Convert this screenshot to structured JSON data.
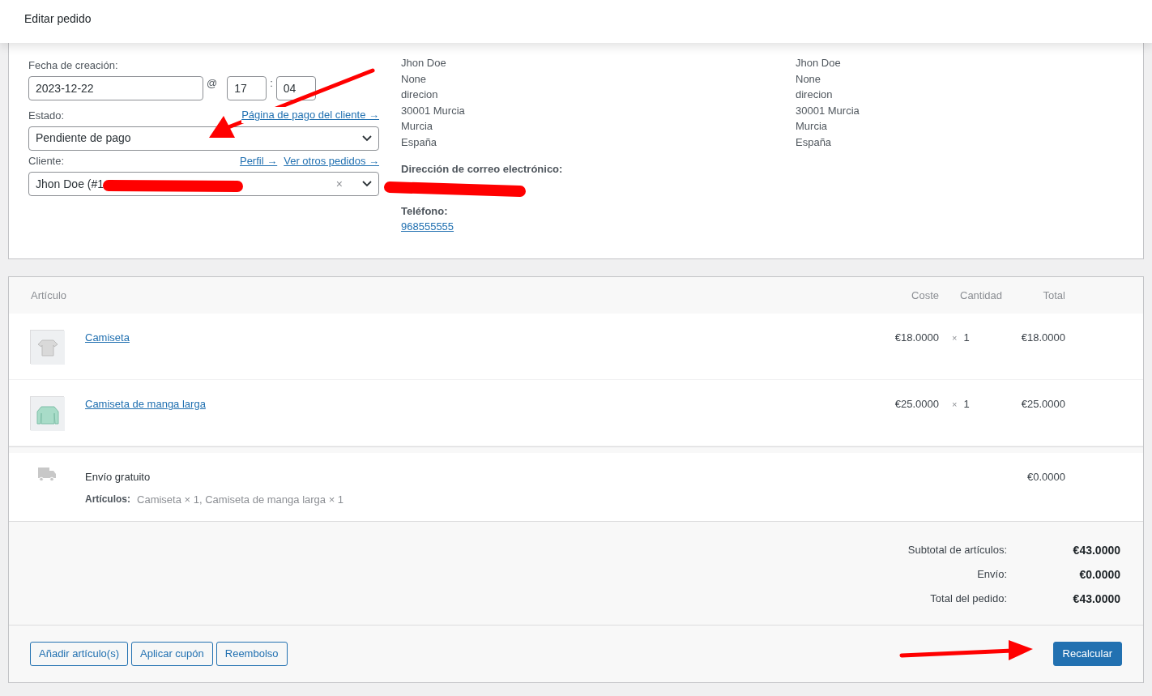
{
  "header": {
    "title": "Editar pedido"
  },
  "general": {
    "date_label": "Fecha de creación:",
    "date": "2023-12-22",
    "at": "@",
    "hour": "17",
    "sep": ":",
    "minute": "04",
    "status_label": "Estado:",
    "payment_link": "Página de pago del cliente →",
    "status": "Pendiente de pago",
    "customer_label": "Cliente:",
    "profile_link": "Perfil →",
    "orders_link": "Ver otros pedidos →",
    "customer": "Jhon Doe (#1",
    "clear": "×"
  },
  "billing": {
    "address": [
      "Jhon Doe",
      "None",
      "direcion",
      "30001 Murcia",
      "Murcia",
      "España"
    ],
    "email_label": "Dirección de correo electrónico:",
    "phone_label": "Teléfono:",
    "phone": "968555555"
  },
  "shipping": {
    "address": [
      "Jhon Doe",
      "None",
      "direcion",
      "30001 Murcia",
      "Murcia",
      "España"
    ]
  },
  "items": {
    "columns": [
      "Artículo",
      "Coste",
      "Cantidad",
      "Total"
    ],
    "rows": [
      {
        "name": "Camiseta",
        "cost": "€18.0000",
        "times": "×",
        "qty": "1",
        "total": "€18.0000"
      },
      {
        "name": "Camiseta de manga larga",
        "cost": "€25.0000",
        "times": "×",
        "qty": "1",
        "total": "€25.0000"
      }
    ]
  },
  "shipping_line": {
    "name": "Envío gratuito",
    "items_label": "Artículos:",
    "items": "Camiseta × 1, Camiseta de manga larga × 1",
    "total": "€0.0000"
  },
  "totals": [
    {
      "label": "Subtotal de artículos:",
      "value": "€43.0000"
    },
    {
      "label": "Envío:",
      "value": "€0.0000"
    },
    {
      "label": "Total del pedido:",
      "value": "€43.0000"
    }
  ],
  "actions": [
    "Añadir artículo(s)",
    "Aplicar cupón",
    "Reembolso"
  ],
  "recalculate": "Recalcular"
}
